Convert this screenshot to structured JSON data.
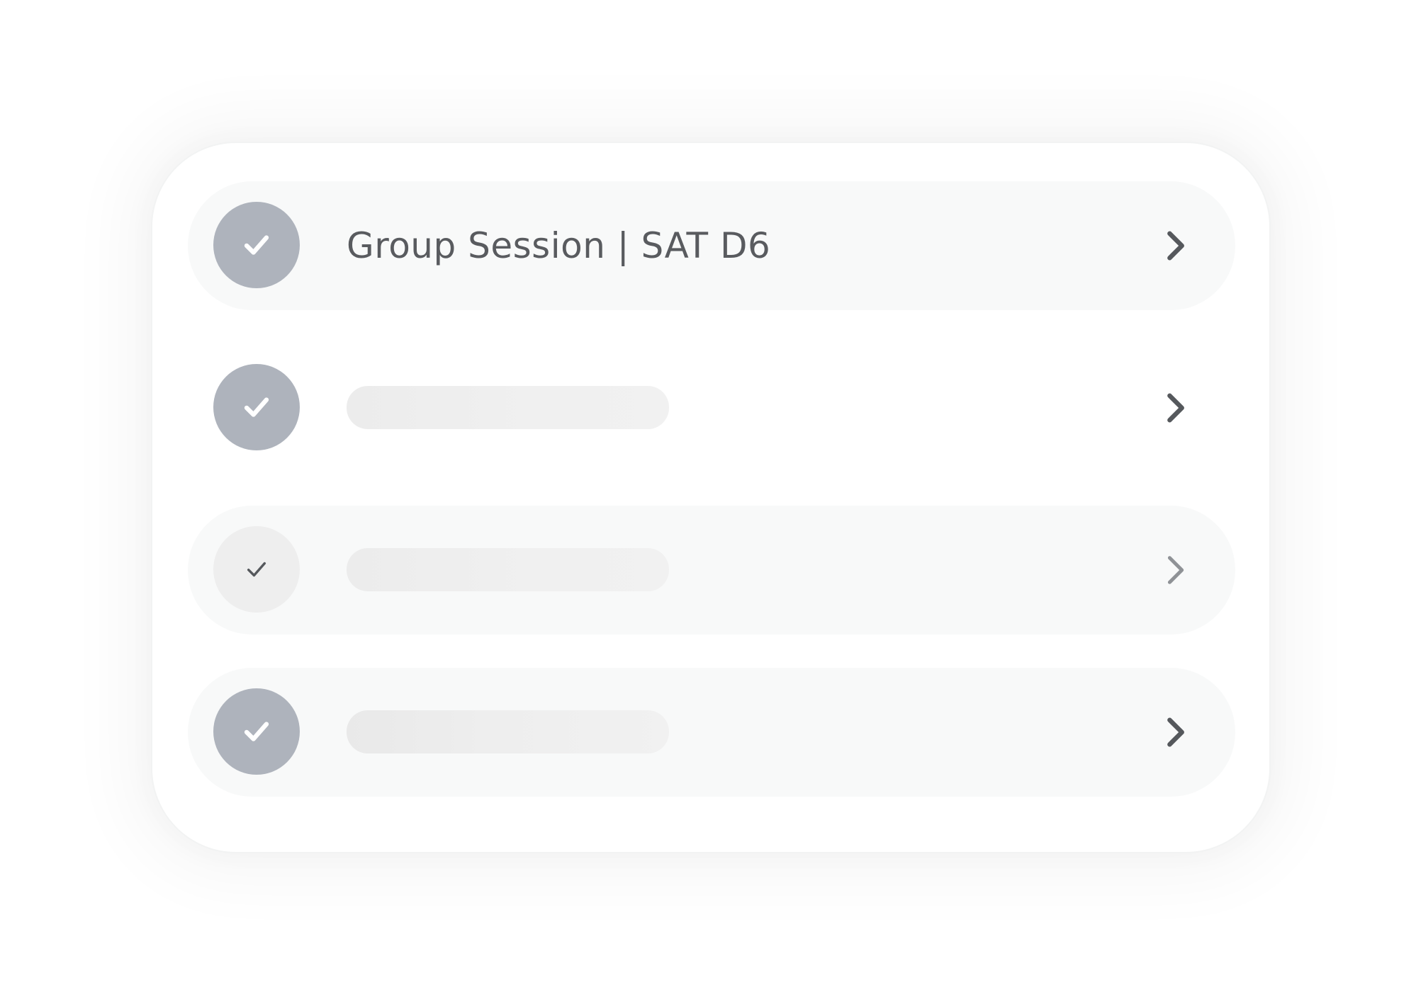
{
  "list": {
    "items": [
      {
        "label": "Group Session | SAT D6",
        "state": "selected",
        "check_icon": "check-icon",
        "chevron_icon": "chevron-right-icon"
      },
      {
        "label": "",
        "state": "placeholder",
        "check_icon": "check-icon",
        "chevron_icon": "chevron-right-icon"
      },
      {
        "label": "",
        "state": "placeholder-faded",
        "check_icon": "check-icon",
        "chevron_icon": "chevron-right-icon"
      },
      {
        "label": "",
        "state": "placeholder",
        "check_icon": "check-icon",
        "chevron_icon": "chevron-right-icon"
      }
    ]
  },
  "colors": {
    "check_circle": "#aeb3bc",
    "check_circle_light": "#eeeeee",
    "row_background": "#f8f9f9",
    "text": "#595b5f",
    "chevron": "#55585c"
  }
}
